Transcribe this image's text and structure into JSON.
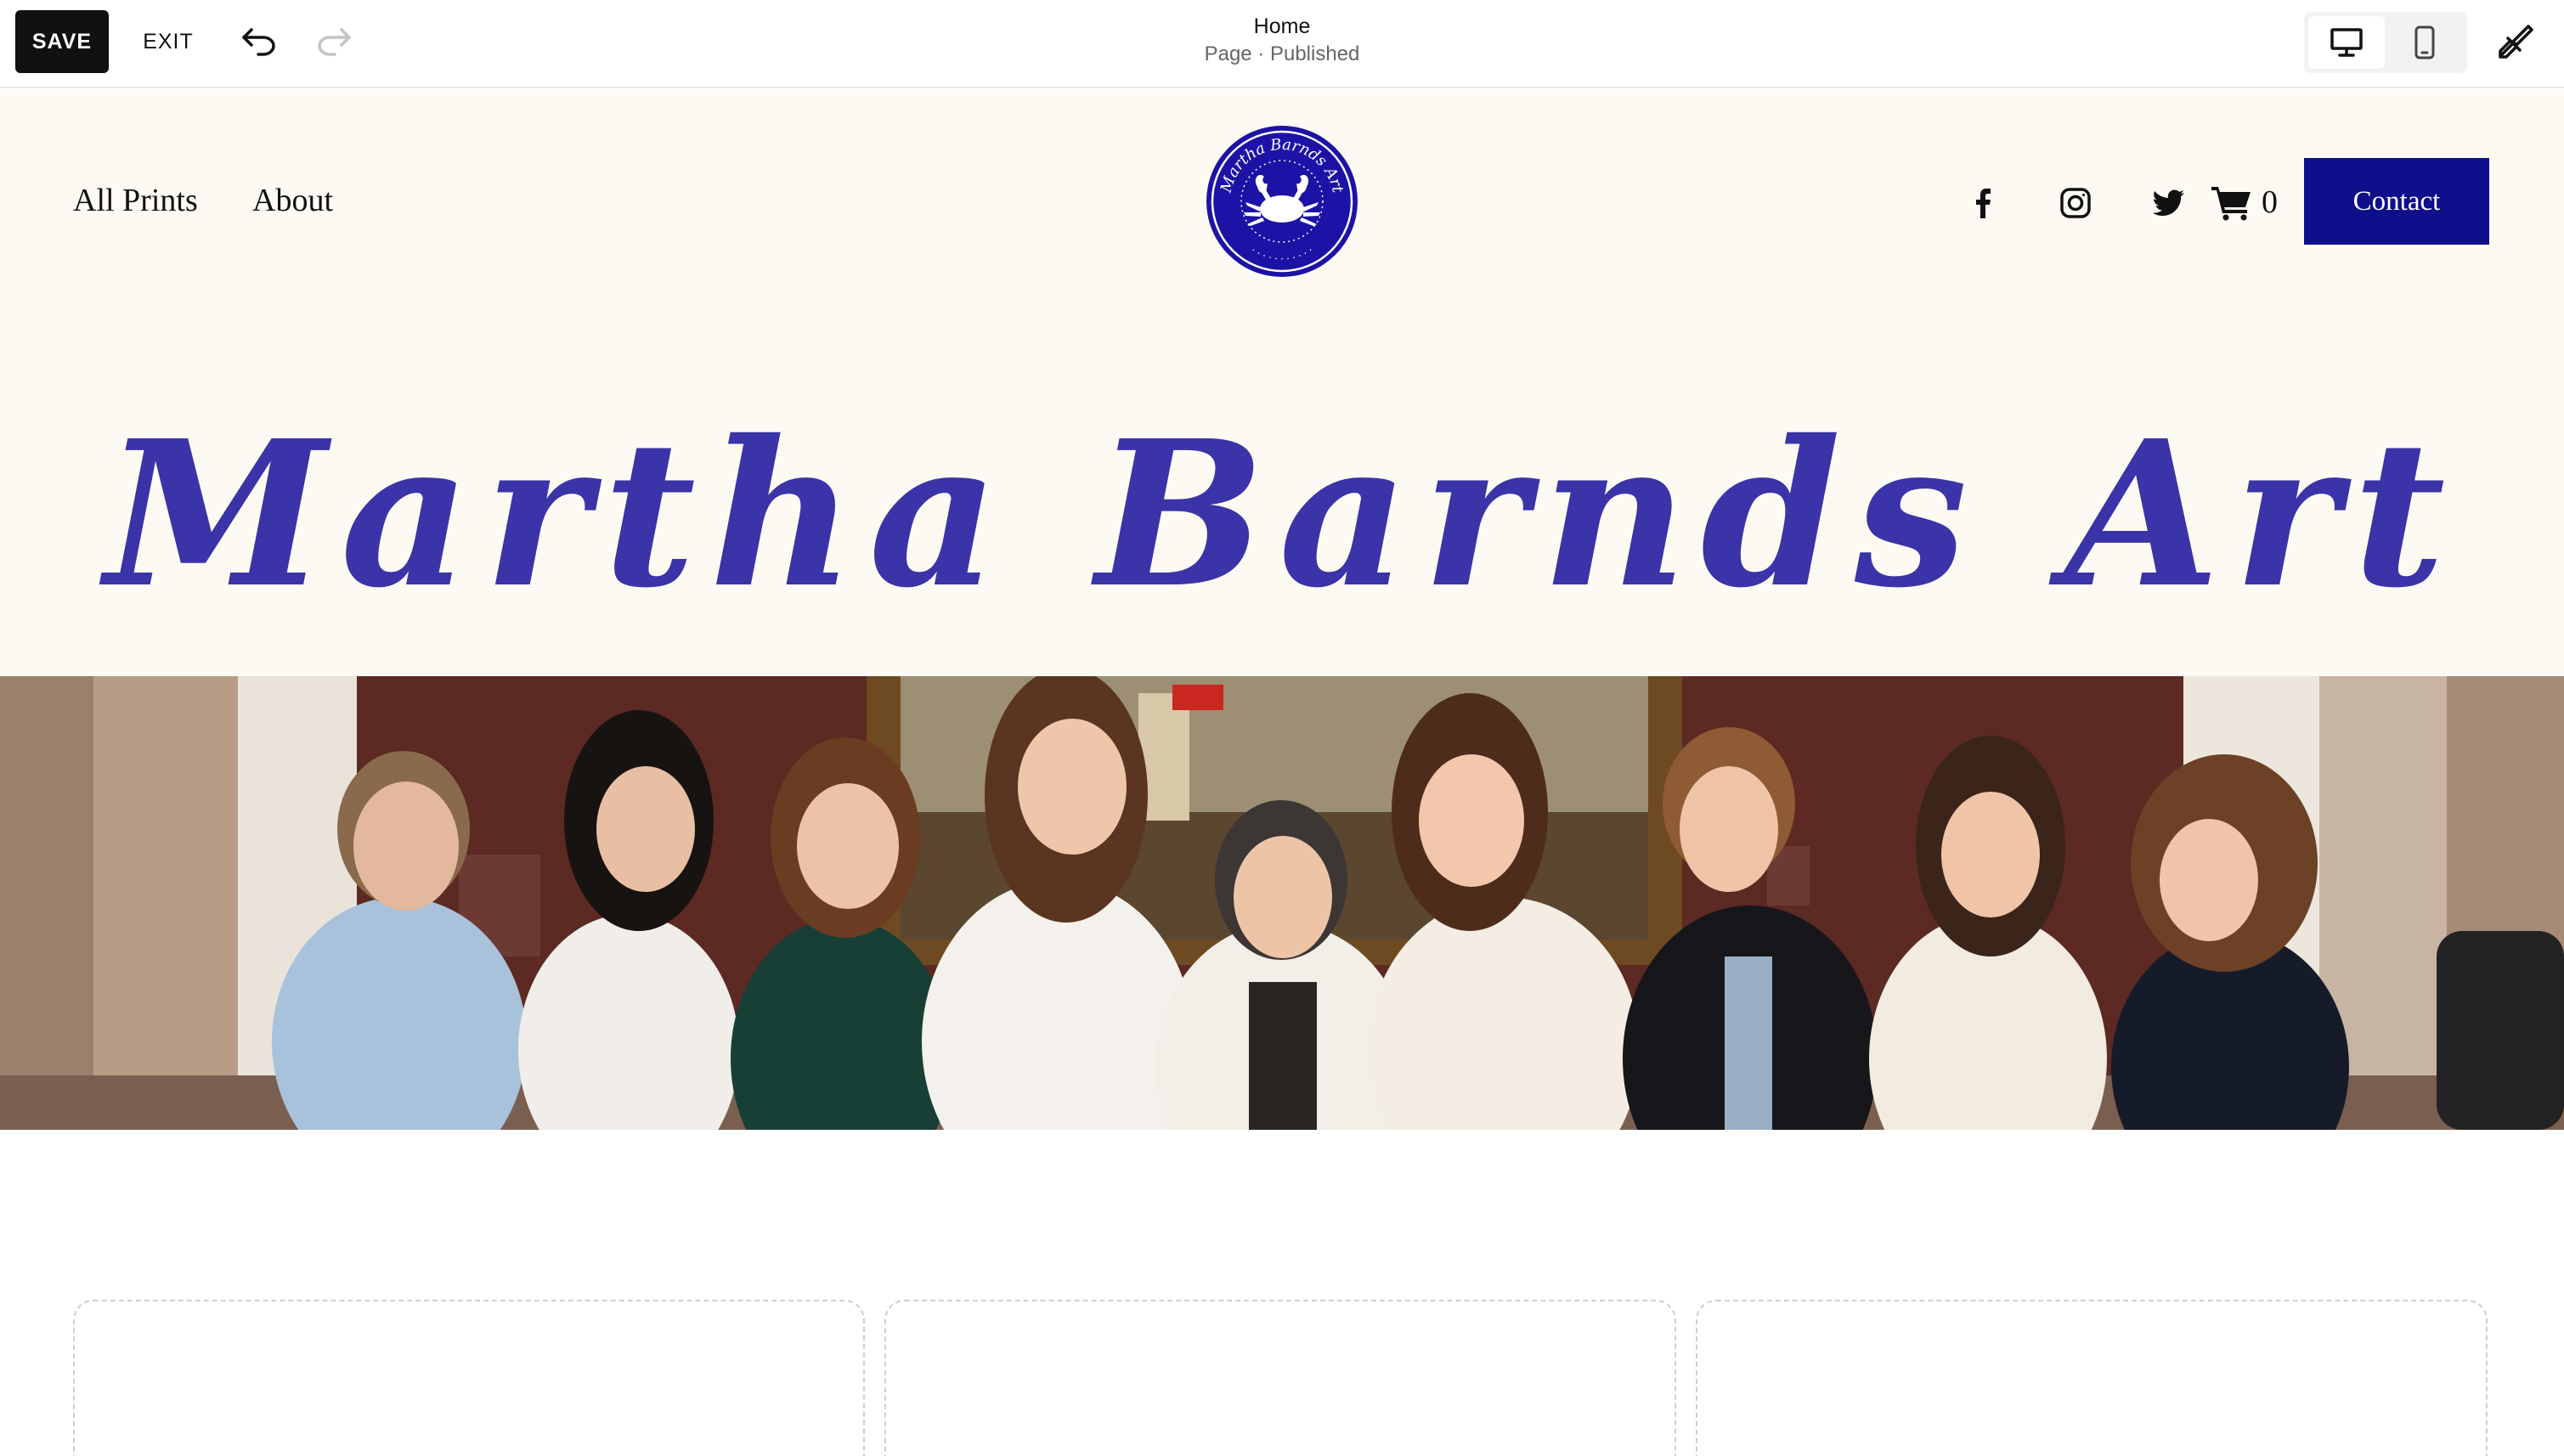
{
  "toolbar": {
    "save_label": "SAVE",
    "exit_label": "EXIT",
    "undo_icon": "undo-icon",
    "redo_icon": "redo-icon",
    "page_title": "Home",
    "page_status": "Page · Published",
    "desktop_view_icon": "desktop-icon",
    "mobile_view_icon": "mobile-icon",
    "design_icon": "paintbrush-icon"
  },
  "site": {
    "nav": [
      "All Prints",
      "About"
    ],
    "logo_text": "Martha Barnds Art",
    "social_icons": [
      "facebook-icon",
      "instagram-icon",
      "twitter-icon"
    ],
    "cart_icon": "cart-icon",
    "cart_count": "0",
    "contact_label": "Contact",
    "hero_title": "Martha Barnds Art",
    "accent_color": "#3a34a8",
    "button_color": "#0f0f8c",
    "background_color": "#fdfaf3"
  }
}
